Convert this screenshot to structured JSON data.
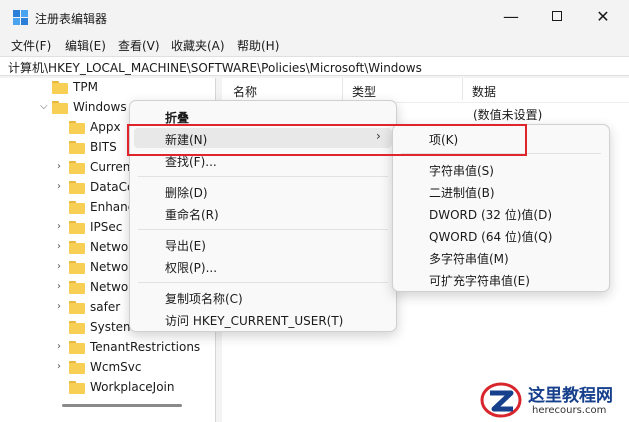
{
  "window": {
    "title": "注册表编辑器",
    "min_glyph": "—",
    "close_glyph": "✕"
  },
  "menu": [
    "文件(F)",
    "编辑(E)",
    "查看(V)",
    "收藏夹(A)",
    "帮助(H)"
  ],
  "address": "计算机\\HKEY_LOCAL_MACHINE\\SOFTWARE\\Policies\\Microsoft\\Windows",
  "tree": {
    "items": [
      {
        "label": "TPM",
        "expanded": false,
        "has_children": false
      },
      {
        "label": "Windows",
        "expanded": true,
        "has_children": true,
        "selected": true
      },
      {
        "label": "Appx",
        "has_children": false
      },
      {
        "label": "BITS",
        "has_children": false
      },
      {
        "label": "Curren",
        "has_children": true
      },
      {
        "label": "DataCo",
        "has_children": true
      },
      {
        "label": "Enhanc",
        "has_children": false
      },
      {
        "label": "IPSec",
        "has_children": true
      },
      {
        "label": "Netwo",
        "has_children": true
      },
      {
        "label": "Netwo",
        "has_children": true
      },
      {
        "label": "Netwo",
        "has_children": true
      },
      {
        "label": "safer",
        "has_children": true
      },
      {
        "label": "System",
        "has_children": false
      },
      {
        "label": "TenantRestrictions",
        "has_children": true
      },
      {
        "label": "WcmSvc",
        "has_children": true
      },
      {
        "label": "WorkplaceJoin",
        "has_children": false
      }
    ]
  },
  "list": {
    "columns": [
      "名称",
      "类型",
      "数据"
    ],
    "data_value": "(数值未设置)"
  },
  "context_menu": {
    "items": [
      {
        "label": "折叠",
        "bold": true
      },
      {
        "label": "新建(N)",
        "submenu": true,
        "highlighted": true
      },
      {
        "label": "查找(F)..."
      },
      {
        "label": "删除(D)"
      },
      {
        "label": "重命名(R)"
      },
      {
        "label": "导出(E)"
      },
      {
        "label": "权限(P)..."
      },
      {
        "label": "复制项名称(C)"
      },
      {
        "label": "访问 HKEY_CURRENT_USER(T)"
      }
    ],
    "submenu_arrow": "›"
  },
  "submenu": {
    "items": [
      {
        "label": "项(K)",
        "highlighted": true
      },
      {
        "label": "字符串值(S)"
      },
      {
        "label": "二进制值(B)"
      },
      {
        "label": "DWORD (32 位)值(D)"
      },
      {
        "label": "QWORD (64 位)值(Q)"
      },
      {
        "label": "多字符串值(M)"
      },
      {
        "label": "可扩充字符串值(E)"
      }
    ]
  },
  "watermark": {
    "title": "这里教程网",
    "url": "herecours.com"
  },
  "colors": {
    "highlight_box": "#e0242b",
    "folder": "#f7cf55",
    "watermark_blue": "#163f8c",
    "watermark_red": "#d8262c"
  }
}
